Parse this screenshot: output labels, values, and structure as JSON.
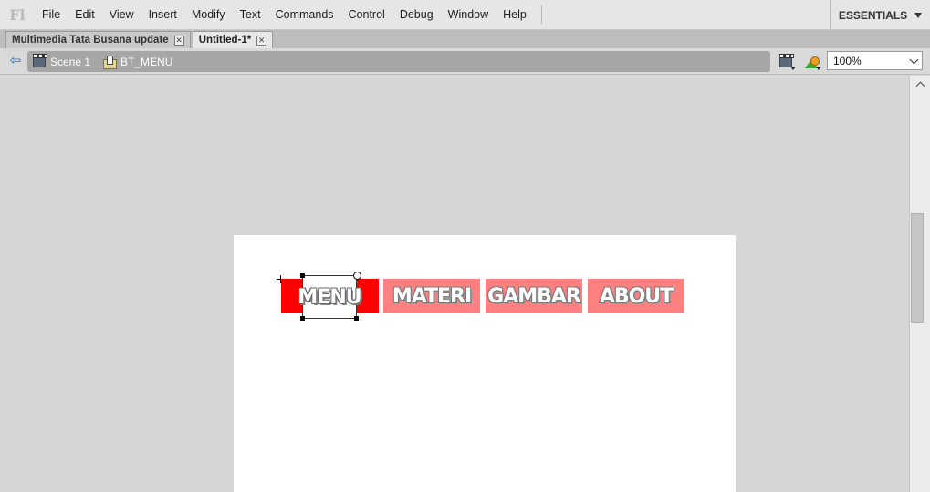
{
  "app": {
    "logo": "Fl"
  },
  "menubar": {
    "items": [
      "File",
      "Edit",
      "View",
      "Insert",
      "Modify",
      "Text",
      "Commands",
      "Control",
      "Debug",
      "Window",
      "Help"
    ],
    "workspace": "ESSENTIALS"
  },
  "tabs": [
    {
      "label": "Multimedia Tata Busana update",
      "active": false
    },
    {
      "label": "Untitled-1*",
      "active": true
    }
  ],
  "editbar": {
    "breadcrumb": [
      {
        "label": "Scene 1",
        "icon": "scene-icon"
      },
      {
        "label": "BT_MENU",
        "icon": "button-symbol-icon"
      }
    ],
    "zoom": "100%"
  },
  "stage": {
    "buttons": [
      {
        "label": "MENU",
        "color": "#ff0000",
        "selected": true
      },
      {
        "label": "MATERI",
        "color": "#ff8080"
      },
      {
        "label": "GAMBAR",
        "color": "#ff8080"
      },
      {
        "label": "ABOUT",
        "color": "#ff8080"
      }
    ]
  },
  "colors": {
    "stage_bg": "#ffffff",
    "workarea_bg": "#d6d6d6",
    "breadcrumb_bg": "#a6a6a6"
  }
}
